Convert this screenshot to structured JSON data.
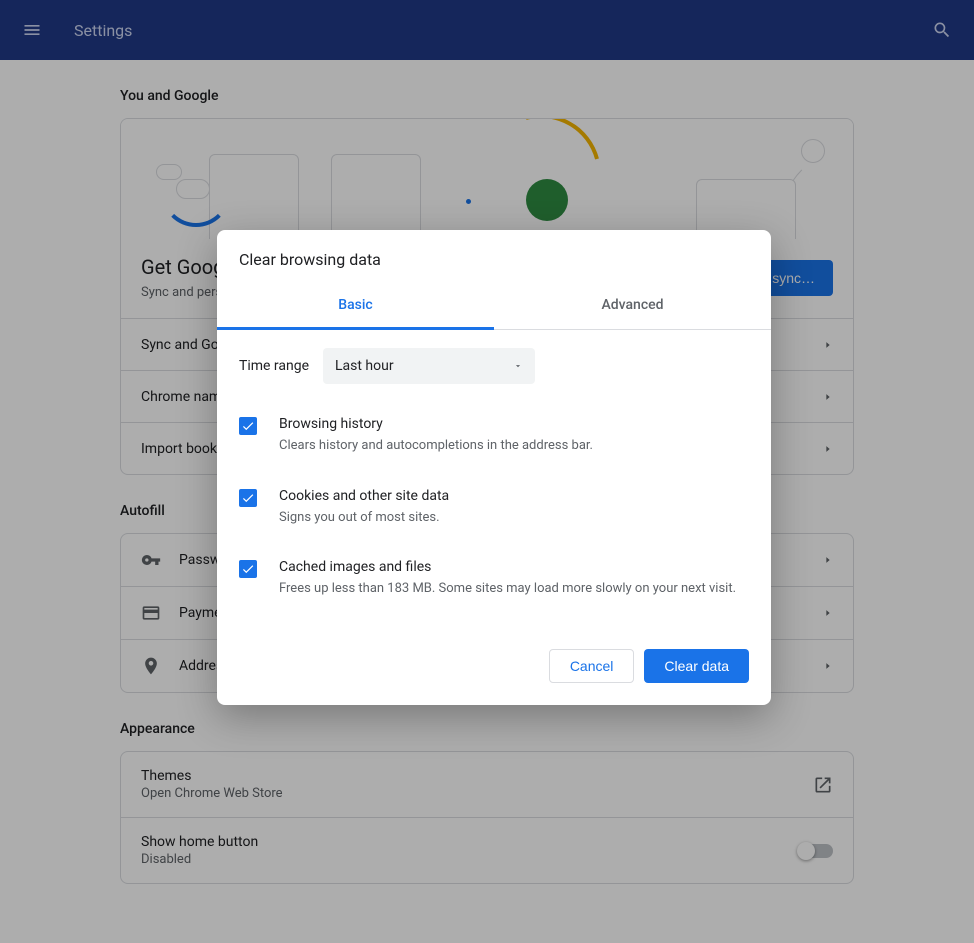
{
  "header": {
    "title": "Settings"
  },
  "sections": {
    "you_google": {
      "title": "You and Google",
      "promo": {
        "heading": "Get Google smarts in Chrome",
        "sub": "Sync and personalize Chrome across your devices",
        "button": "Turn on sync…"
      },
      "rows": [
        {
          "label": "Sync and Google services"
        },
        {
          "label": "Chrome name and picture"
        },
        {
          "label": "Import bookmarks and settings"
        }
      ]
    },
    "autofill": {
      "title": "Autofill",
      "rows": [
        {
          "label": "Passwords"
        },
        {
          "label": "Payment methods"
        },
        {
          "label": "Addresses and more"
        }
      ]
    },
    "appearance": {
      "title": "Appearance",
      "rows": [
        {
          "label": "Themes",
          "sub": "Open Chrome Web Store"
        },
        {
          "label": "Show home button",
          "sub": "Disabled"
        }
      ]
    }
  },
  "modal": {
    "title": "Clear browsing data",
    "tabs": {
      "basic": "Basic",
      "advanced": "Advanced"
    },
    "time_range_label": "Time range",
    "time_range_value": "Last hour",
    "items": [
      {
        "title": "Browsing history",
        "sub": "Clears history and autocompletions in the address bar."
      },
      {
        "title": "Cookies and other site data",
        "sub": "Signs you out of most sites."
      },
      {
        "title": "Cached images and files",
        "sub": "Frees up less than 183 MB. Some sites may load more slowly on your next visit."
      }
    ],
    "cancel": "Cancel",
    "clear": "Clear data"
  }
}
